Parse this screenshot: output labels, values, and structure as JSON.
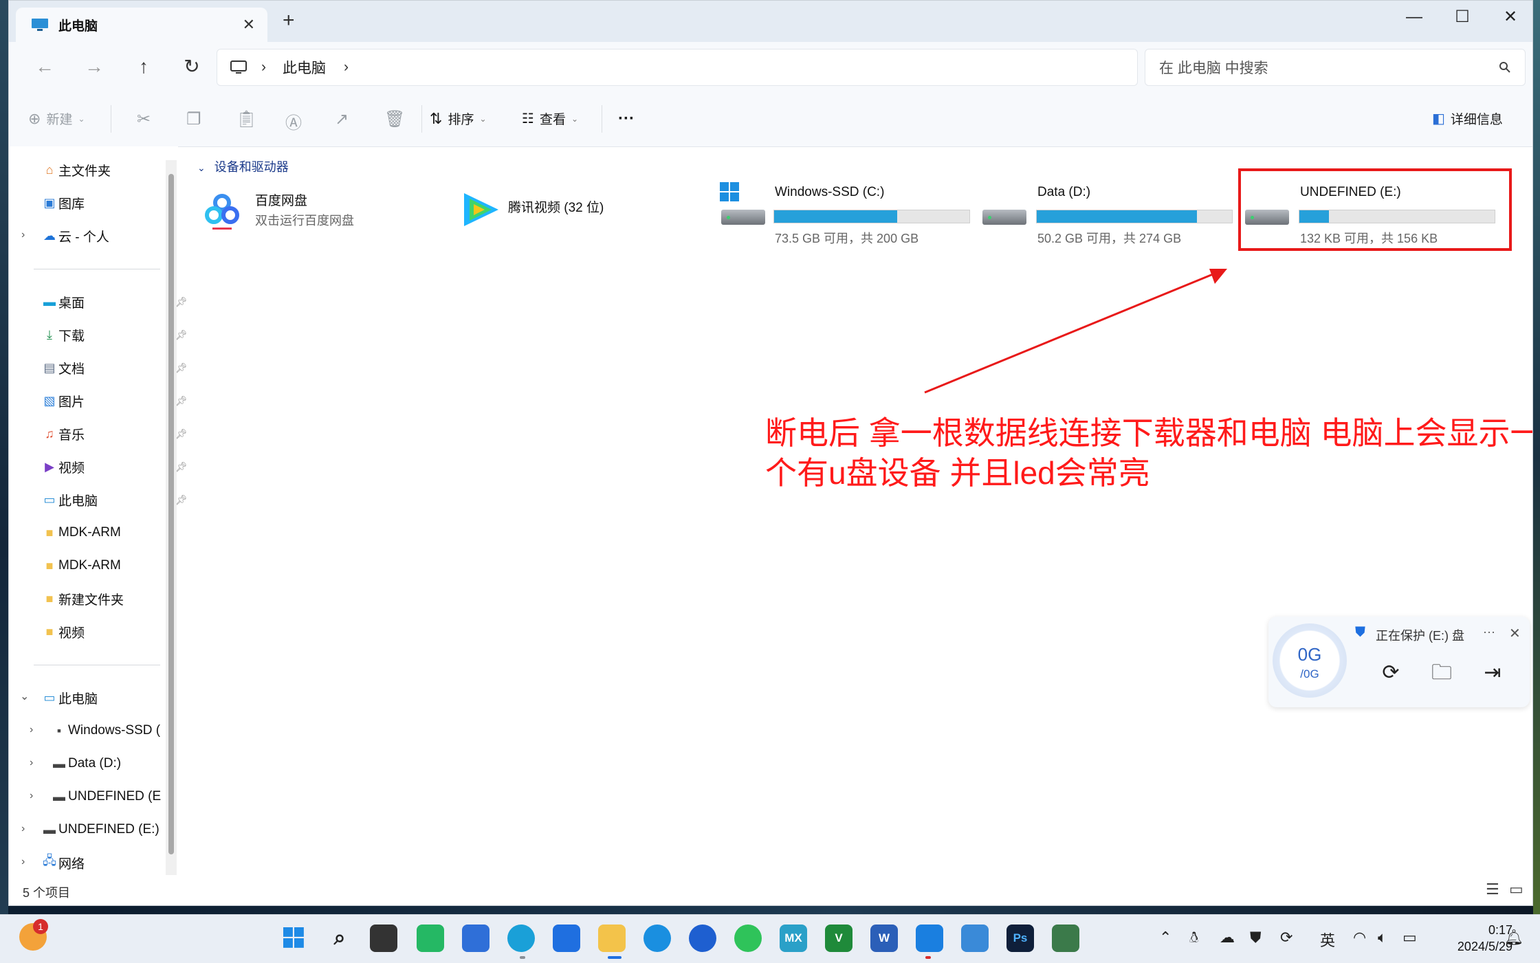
{
  "window": {
    "tab_title": "此电脑",
    "tab_close": "✕",
    "new_tab": "+",
    "minimize": "—",
    "maximize": "☐",
    "close": "✕"
  },
  "nav": {
    "back": "←",
    "forward": "→",
    "up": "↑",
    "refresh": "↻",
    "breadcrumb": [
      "此电脑"
    ],
    "breadcrumb_sep": "›",
    "search_placeholder": "在 此电脑 中搜索"
  },
  "toolbar": {
    "new_label": "新建",
    "sort_label": "排序",
    "view_label": "查看",
    "more_label": "···",
    "details_label": "详细信息"
  },
  "sidebar": {
    "top": [
      {
        "label": "主文件夹",
        "icon": "home-icon"
      },
      {
        "label": "图库",
        "icon": "gallery-icon"
      },
      {
        "label": "云 - 个人",
        "icon": "cloud-icon"
      }
    ],
    "pinned": [
      {
        "label": "桌面",
        "icon": "desktop-icon",
        "pinned": true
      },
      {
        "label": "下载",
        "icon": "download-icon",
        "pinned": true
      },
      {
        "label": "文档",
        "icon": "document-icon",
        "pinned": true
      },
      {
        "label": "图片",
        "icon": "pictures-icon",
        "pinned": true
      },
      {
        "label": "音乐",
        "icon": "music-icon",
        "pinned": true
      },
      {
        "label": "视频",
        "icon": "video-icon",
        "pinned": true
      },
      {
        "label": "此电脑",
        "icon": "computer-icon",
        "pinned": true
      },
      {
        "label": "MDK-ARM",
        "icon": "folder-icon",
        "pinned": false
      },
      {
        "label": "MDK-ARM",
        "icon": "folder-icon",
        "pinned": false
      },
      {
        "label": "新建文件夹",
        "icon": "folder-icon",
        "pinned": false
      },
      {
        "label": "视频",
        "icon": "folder-icon",
        "pinned": false
      }
    ],
    "tree": [
      {
        "label": "此电脑",
        "expanded": true
      },
      {
        "label": "Windows-SSD (",
        "child": true
      },
      {
        "label": "Data (D:)",
        "child": true
      },
      {
        "label": "UNDEFINED (E",
        "child": true
      },
      {
        "label": "UNDEFINED (E:)",
        "child": false
      },
      {
        "label": "网络",
        "child": false
      }
    ]
  },
  "main": {
    "group_header": "设备和驱动器",
    "apps": [
      {
        "name": "百度网盘",
        "sub": "双击运行百度网盘"
      },
      {
        "name": "腾讯视频 (32 位)",
        "sub": ""
      }
    ],
    "drives": [
      {
        "name": "Windows-SSD (C:)",
        "free": "73.5 GB 可用，共 200 GB",
        "used_fraction": 0.63
      },
      {
        "name": "Data (D:)",
        "free": "50.2 GB 可用，共 274 GB",
        "used_fraction": 0.82
      },
      {
        "name": "UNDEFINED (E:)",
        "free": "132 KB 可用，共 156 KB",
        "used_fraction": 0.15
      }
    ],
    "annotation": "断电后 拿一根数据线连接下载器和电脑 电脑上会显示一个有u盘设备 并且led会常亮"
  },
  "status": {
    "item_count": "5 个项目"
  },
  "popup": {
    "value": "0G",
    "sub": "/0G",
    "title": "正在保护 (E:) 盘",
    "more": "···",
    "close": "✕"
  },
  "taskbar": {
    "notification_badge": "1",
    "tray_lang": "英",
    "time": "0:17",
    "date": "2024/5/29",
    "apps": [
      "windows-start-icon",
      "search-icon",
      "task-view-icon",
      "wechat-work-icon",
      "store-icon",
      "edge-icon",
      "shield-app-icon",
      "file-explorer-icon",
      "ie-icon",
      "feather-app-icon",
      "wechat-icon",
      "mx-app-icon",
      "vs-app-icon",
      "word-icon",
      "phone-link-icon",
      "photos-icon",
      "photoshop-icon",
      "terminal-icon"
    ]
  },
  "colors": {
    "accent": "#26a0da",
    "annotation_red": "#ff1a1a",
    "header_blue": "#1b3a8a"
  }
}
